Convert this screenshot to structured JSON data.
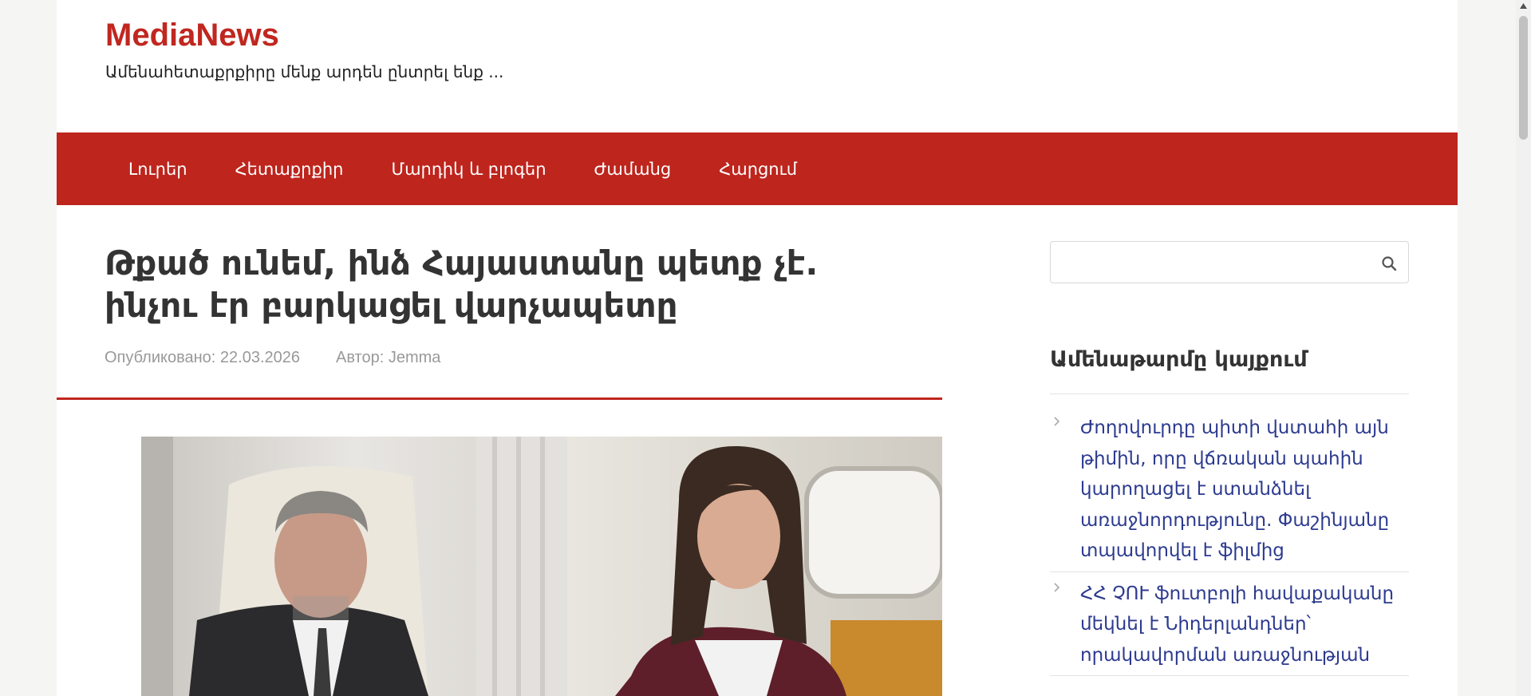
{
  "site": {
    "title": "MediaNews",
    "tagline": "Ամենաhետաքրքիրը մենք արդեն ընտրել ենք ..."
  },
  "nav": {
    "items": [
      "Լուրեր",
      "Հետաքրքիր",
      "Մարդիկ և բլոգեր",
      "Ժամանց",
      "Հարցում"
    ]
  },
  "article": {
    "title": "Թքած ունեմ, ինձ Հայաստանը պետք չէ. ինչու էր բարկացել վարչապետը",
    "published": "Опубликовано: 22.03.2026",
    "author": "Автор: Jemma",
    "image_alt_icon": "featured-photo"
  },
  "sidebar": {
    "search": {
      "value": "",
      "placeholder": ""
    },
    "widget_title": "Ամենաթարմը կայքում",
    "posts": [
      "Ժողովուրդը պիտի վստահի այն թիմին, որը վճռական պահին կարողացել է ստանձնել առաջնորդությունը. Փաշինյանը տպավորվել է ֆիլմից",
      "ՀՀ ՉՈՒ ֆուտբոլի հավաքականը մեկնել է Նիդերլանդներ՝ որակավորման առաջնության"
    ]
  },
  "colors": {
    "brand_red": "#bd251d",
    "link_blue": "#2c3a8f",
    "meta_gray": "#999999"
  }
}
